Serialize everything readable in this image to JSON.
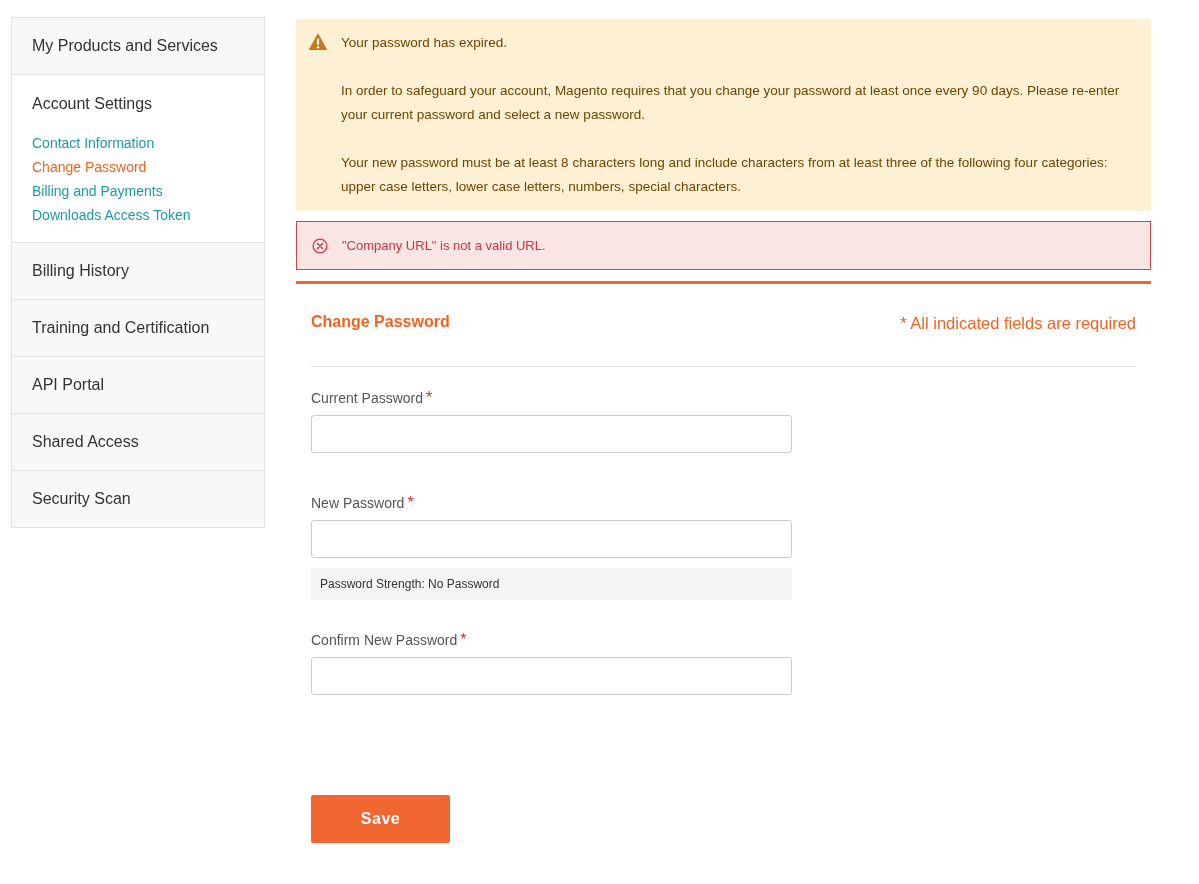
{
  "sidebar": {
    "items": [
      {
        "label": "My Products and Services"
      },
      {
        "label": "Account Settings",
        "children": [
          {
            "label": "Contact Information",
            "selected": false
          },
          {
            "label": "Change Password",
            "selected": true
          },
          {
            "label": "Billing and Payments",
            "selected": false
          },
          {
            "label": "Downloads Access Token",
            "selected": false
          }
        ]
      },
      {
        "label": "Billing History"
      },
      {
        "label": "Training and Certification"
      },
      {
        "label": "API Portal"
      },
      {
        "label": "Shared Access"
      },
      {
        "label": "Security Scan"
      }
    ]
  },
  "warning": {
    "title": "Your password has expired.",
    "paragraphs": [
      "In order to safeguard your account, Magento requires that you change your password at least once every 90 days. Please re-enter your current password and select a new password.",
      "Your new password must be at least 8 characters long and include characters from at least three of the following four categories: upper case letters, lower case letters, numbers, special characters."
    ]
  },
  "error": {
    "message": "\"Company URL\" is not a valid URL."
  },
  "form": {
    "title": "Change Password",
    "required_note": "* All indicated fields are required",
    "fields": [
      {
        "label": "Current Password",
        "required_mark": "*"
      },
      {
        "label": "New Password",
        "required_mark": "*",
        "strength": "Password Strength: No Password"
      },
      {
        "label": "Confirm New Password",
        "required_mark": "*"
      }
    ],
    "save_button": "Save"
  }
}
